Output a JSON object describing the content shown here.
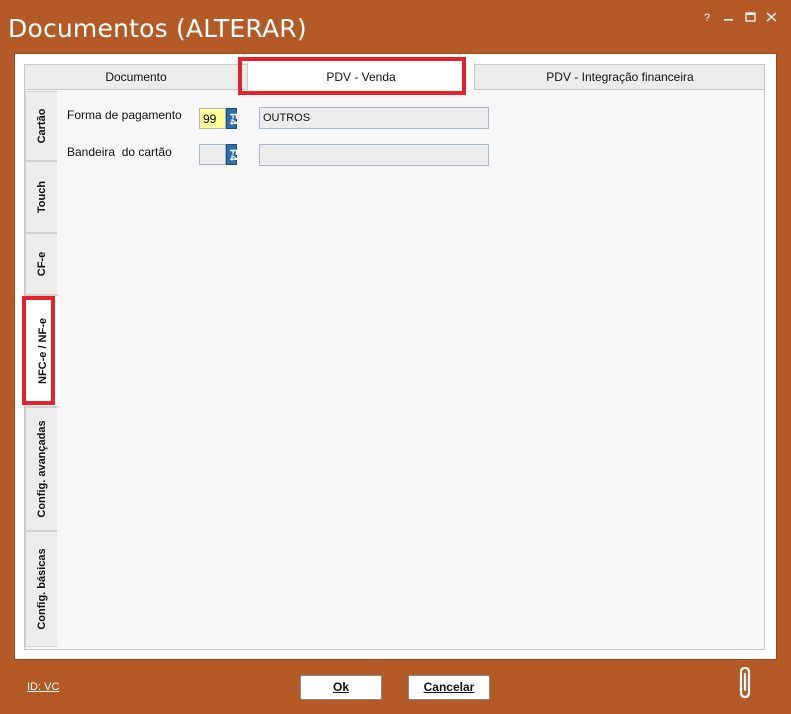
{
  "window": {
    "title": "Documentos (ALTERAR)",
    "controls": [
      "question-icon",
      "minimize-icon",
      "maximize-icon",
      "close-icon"
    ]
  },
  "top_tabs": [
    {
      "label": "Documento"
    },
    {
      "label": "PDV - Venda"
    },
    {
      "label": "PDV - Integração financeira"
    }
  ],
  "side_tabs": [
    {
      "label": "Cartão"
    },
    {
      "label": "Touch"
    },
    {
      "label": "CF-e"
    },
    {
      "label": "NFC-e / NF-e"
    },
    {
      "label": "Config. avançadas"
    },
    {
      "label": "Config. básicas"
    }
  ],
  "form": {
    "payment": {
      "label": "Forma de pagamento",
      "code": "99",
      "lookup_key": "F4",
      "description": "OUTROS"
    },
    "card_flag": {
      "label": "Bandeira  do cartão",
      "code": "",
      "lookup_key": "F4",
      "description": ""
    }
  },
  "footer": {
    "id_link": "ID: VC",
    "ok_label": "Ok",
    "cancel_label": "Cancelar",
    "attach_icon": "paperclip-icon"
  },
  "colors": {
    "window_bg": "#b45a27",
    "highlight": "#e8202a",
    "code_field_bg": "#ffff99",
    "lookup_button": "#2e6fa8"
  }
}
